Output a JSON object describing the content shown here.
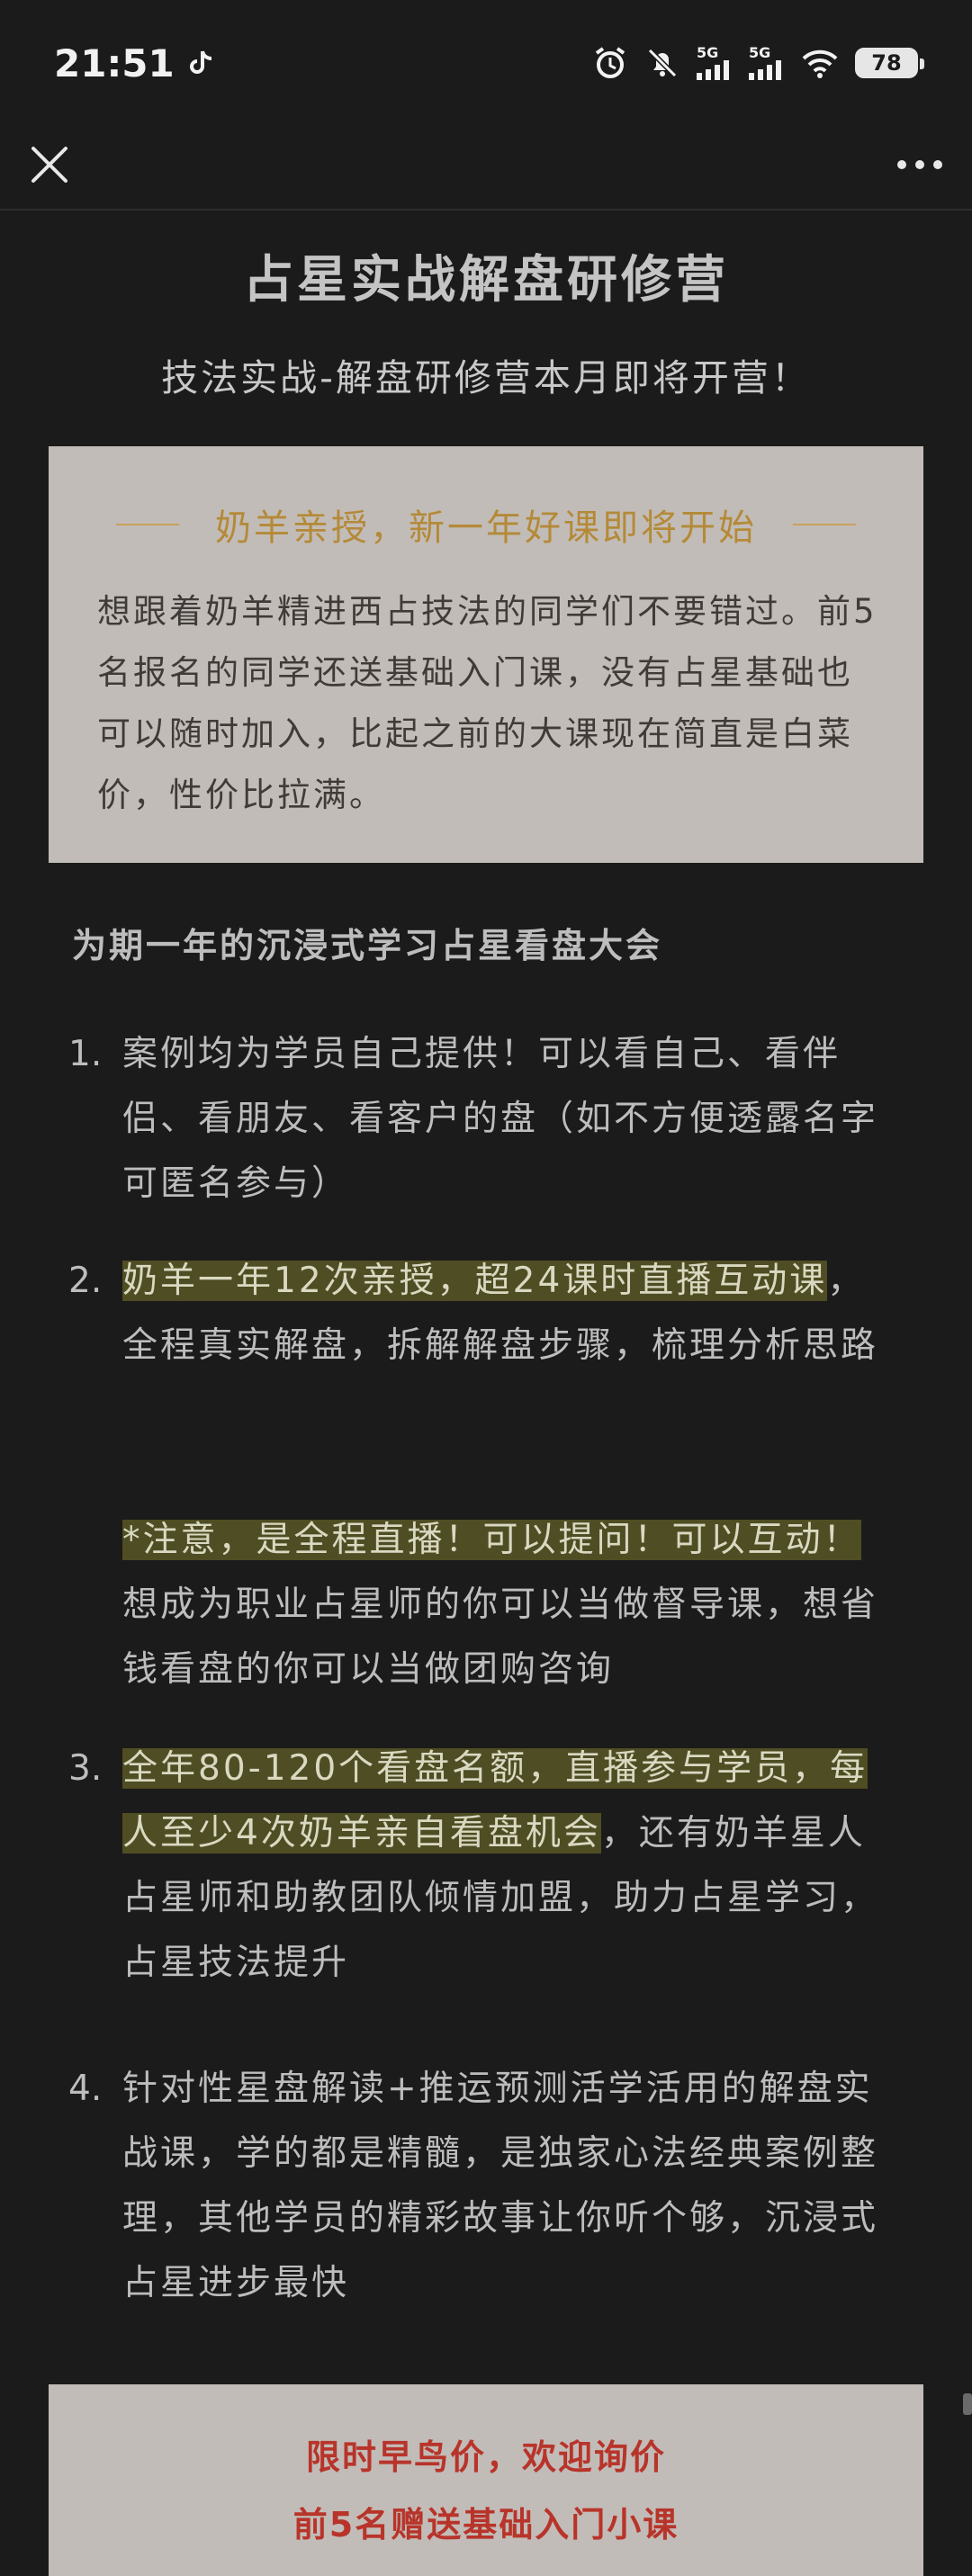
{
  "status_bar": {
    "time": "21:51",
    "net1": "5G",
    "net2": "5G",
    "battery": "78"
  },
  "page": {
    "title": "占星实战解盘研修营",
    "subtitle": "技法实战-解盘研修营本月即将开营！",
    "box1": {
      "title": "奶羊亲授，新一年好课即将开始",
      "text": "想跟着奶羊精进西占技法的同学们不要错过。前5名报名的同学还送基础入门课，没有占星基础也可以随时加入，比起之前的大课现在简直是白菜价，性价比拉满。"
    },
    "section_title": "为期一年的沉浸式学习占星看盘大会",
    "items": [
      {
        "num": "1.",
        "text": "案例均为学员自己提供！可以看自己、看伴侣、看朋友、看客户的盘（如不方便透露名字可匿名参与）"
      },
      {
        "num": "2.",
        "hl": "奶羊一年12次亲授，超24课时直播互动课",
        "rest": "，全程真实解盘，拆解解盘步骤，梳理分析思路",
        "note_hl": "*注意，是全程直播！可以提问！可以互动！",
        "note_rest": "想成为职业占星师的你可以当做督导课，想省钱看盘的你可以当做团购咨询"
      },
      {
        "num": "3.",
        "hl": "全年80-120个看盘名额，直播参与学员，每人至少4次奶羊亲自看盘机会",
        "rest": "，还有奶羊星人占星师和助教团队倾情加盟，助力占星学习，占星技法提升"
      },
      {
        "num": "4.",
        "text": "针对性星盘解读+推运预测活学活用的解盘实战课，学的都是精髓，是独家心法经典案例整理，其他学员的精彩故事让你听个够，沉浸式占星进步最快"
      }
    ],
    "box2": {
      "line1": "限时早鸟价，欢迎询价",
      "line2": "前5名赠送基础入门小课"
    }
  }
}
